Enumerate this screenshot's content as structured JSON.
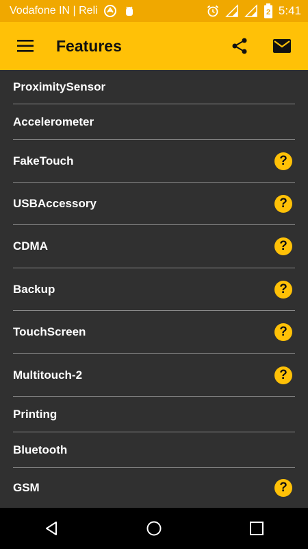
{
  "status_bar": {
    "carrier": "Vodafone IN | Reli",
    "battery_level": "2",
    "time": "5:41",
    "icons": [
      "app-notification-icon",
      "android-debug-icon",
      "alarm-icon",
      "signal-icon",
      "signal-icon",
      "battery-icon"
    ]
  },
  "app_bar": {
    "title": "Features",
    "icons": [
      "menu-icon",
      "share-icon",
      "mail-icon"
    ]
  },
  "features": [
    {
      "label": "ProximitySensor",
      "help": false
    },
    {
      "label": "Accelerometer",
      "help": false
    },
    {
      "label": "FakeTouch",
      "help": true
    },
    {
      "label": "USBAccessory",
      "help": true
    },
    {
      "label": "CDMA",
      "help": true
    },
    {
      "label": "Backup",
      "help": true
    },
    {
      "label": "TouchScreen",
      "help": true
    },
    {
      "label": "Multitouch-2",
      "help": true
    },
    {
      "label": "Printing",
      "help": false
    },
    {
      "label": "Bluetooth",
      "help": false
    },
    {
      "label": "GSM",
      "help": true
    }
  ],
  "help_glyph": "?",
  "nav_bar": {
    "icons": [
      "back-icon",
      "home-icon",
      "recents-icon"
    ]
  },
  "colors": {
    "status_bar": "#F0A800",
    "app_bar": "#FFC107",
    "background": "#303030",
    "accent": "#FFC107",
    "nav_bar": "#000000"
  }
}
